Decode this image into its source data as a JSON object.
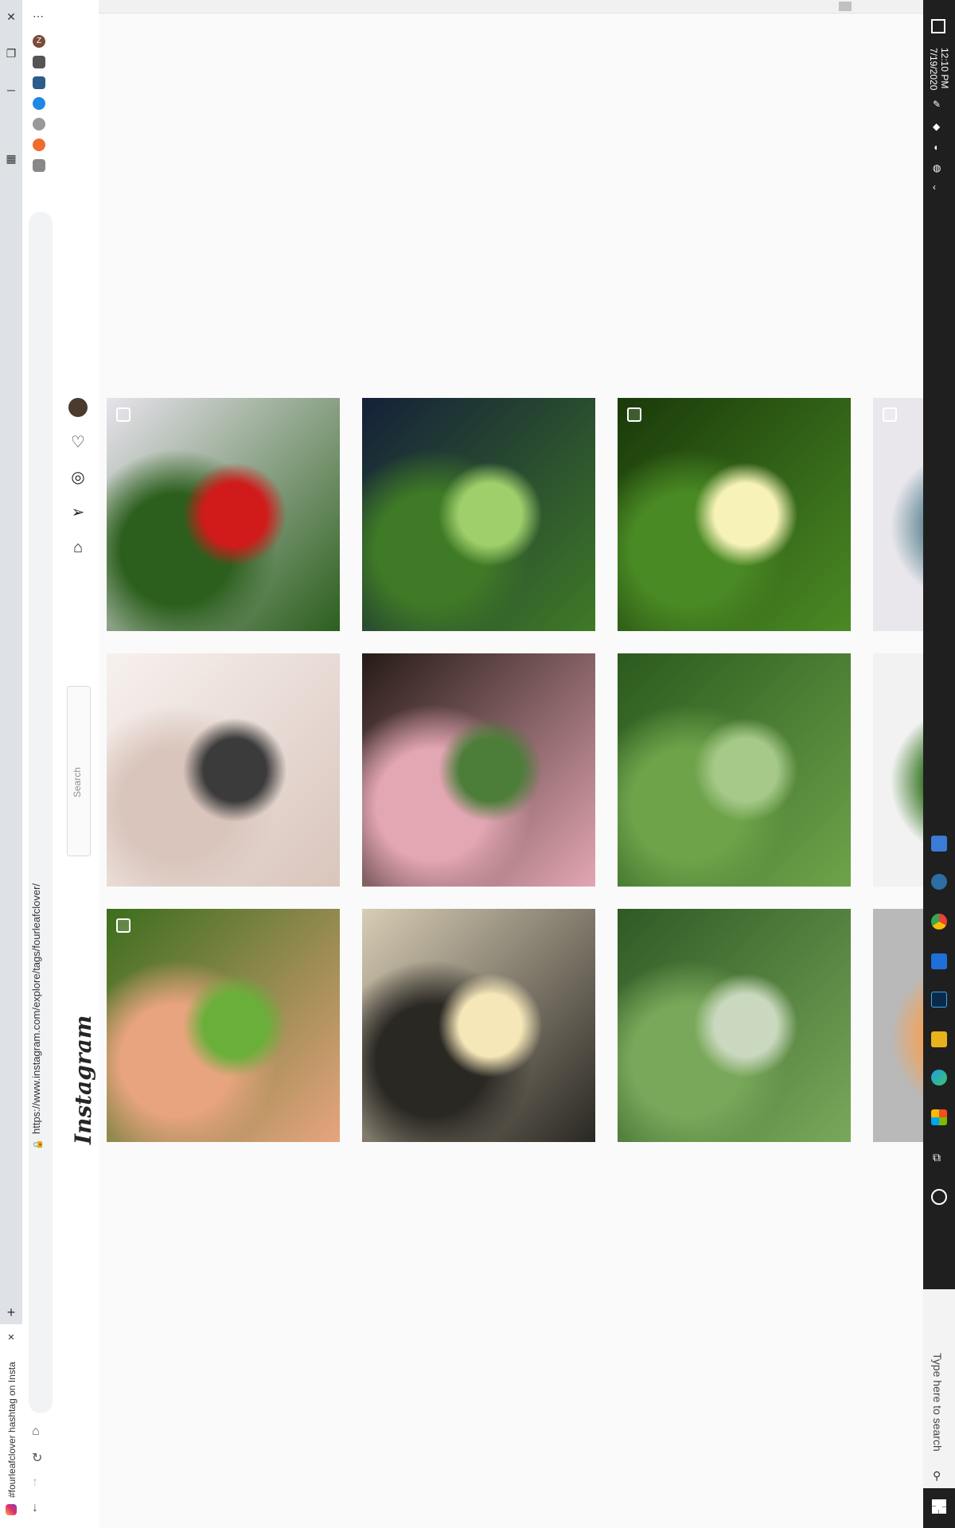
{
  "browser": {
    "tab_title": "#fourleafclover hashtag on Insta",
    "url": "https://www.instagram.com/explore/tags/fourleafclover/",
    "profile_initial": "Z"
  },
  "instagram": {
    "logo": "Instagram",
    "search_placeholder": "Search",
    "nav_icons": [
      "profile-avatar",
      "heart-icon",
      "compass-icon",
      "direct-icon",
      "home-icon"
    ]
  },
  "grid": {
    "posts": [
      {
        "name": "mask-on-clover",
        "colors": [
          "#e7e3ec",
          "#2c5f1d",
          "#d11a1a"
        ],
        "badge": "camera"
      },
      {
        "name": "four-leaf-dark",
        "colors": [
          "#142039",
          "#3f7a26",
          "#9fcf6b"
        ],
        "badge": ""
      },
      {
        "name": "daisy-clover",
        "colors": [
          "#1a3a0a",
          "#4a8a24",
          "#f7f2b8"
        ],
        "badge": "multi"
      },
      {
        "name": "partial-right-1",
        "colors": [
          "#e9e7ec",
          "#6b8f9c"
        ],
        "badge": "multi"
      },
      {
        "name": "tattoo-lucky",
        "colors": [
          "#f7f1ee",
          "#d9c5bc",
          "#3b3b3b"
        ],
        "badge": ""
      },
      {
        "name": "clover-on-hand",
        "colors": [
          "#261b16",
          "#e3a6b3",
          "#4c7e3a"
        ],
        "badge": ""
      },
      {
        "name": "clover-in-grass",
        "colors": [
          "#2b5a1e",
          "#6ea34a",
          "#a6c98a"
        ],
        "badge": ""
      },
      {
        "name": "partial-right-2",
        "colors": [
          "#f2f2f2",
          "#3d7a2a"
        ],
        "badge": ""
      },
      {
        "name": "clover-on-fingers",
        "colors": [
          "#3b6e1d",
          "#e8a47e",
          "#6aaf3a"
        ],
        "badge": "multi"
      },
      {
        "name": "gothic-quatrefoil",
        "colors": [
          "#d8cdb5",
          "#2a2823",
          "#f6e7b8"
        ],
        "badge": ""
      },
      {
        "name": "clover-weeds",
        "colors": [
          "#2f5a25",
          "#7aa85a",
          "#c9d8be"
        ],
        "badge": ""
      },
      {
        "name": "partial-right-3",
        "colors": [
          "#b9b9b9",
          "#f1a35a"
        ],
        "badge": ""
      }
    ]
  },
  "taskbar": {
    "time": "12:10 PM",
    "date": "7/19/2020",
    "search_placeholder": "Type here to search"
  }
}
